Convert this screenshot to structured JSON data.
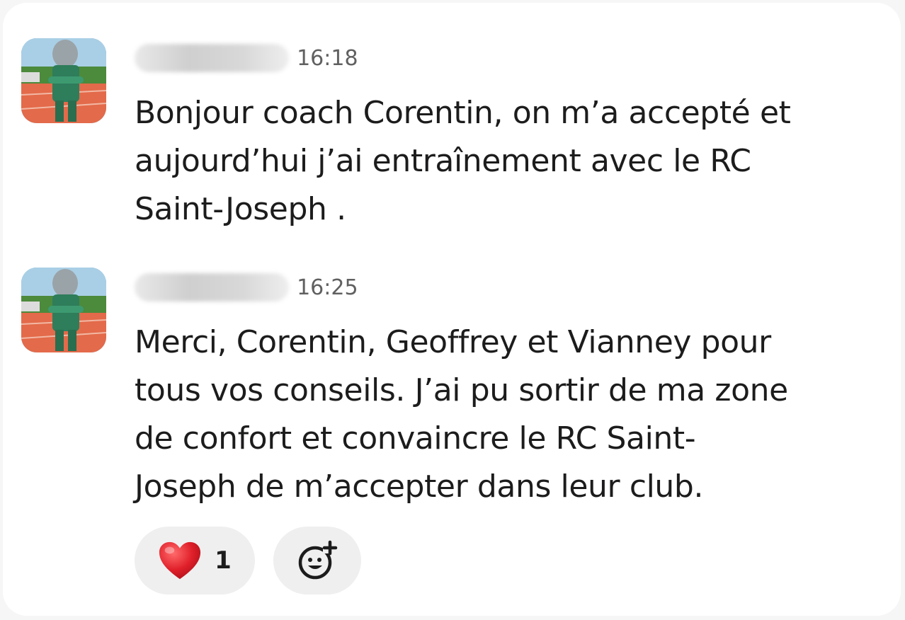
{
  "messages": [
    {
      "time": "16:18",
      "lines": [
        "Bonjour coach Corentin, on m’a accepté et",
        "aujourd’hui j’ai entraînement avec le RC",
        "Saint-Joseph ."
      ]
    },
    {
      "time": "16:25",
      "lines": [
        "Merci, Corentin,  Geoffrey et Vianney pour",
        "tous vos conseils. J’ai pu sortir de ma zone",
        "de confort et convaincre le RC Saint-",
        "Joseph de m’accepter dans leur club."
      ],
      "reactions": [
        {
          "emoji": "heart-emoji",
          "count": "1"
        }
      ]
    }
  ],
  "icons": {
    "add_reaction": "add-reaction-icon"
  },
  "colors": {
    "reaction_bg": "#efefef",
    "timestamp": "#616061",
    "heart": "#e0202a"
  }
}
